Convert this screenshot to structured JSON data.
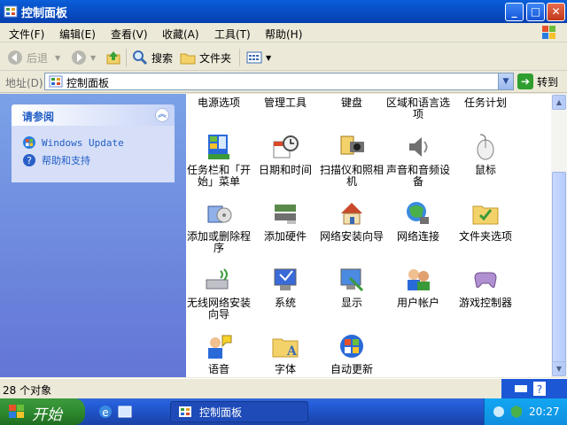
{
  "window": {
    "title": "控制面板",
    "buttons": {
      "minimize": "_",
      "maximize": "□",
      "close": "✕"
    }
  },
  "menu": [
    "文件(F)",
    "编辑(E)",
    "查看(V)",
    "收藏(A)",
    "工具(T)",
    "帮助(H)"
  ],
  "toolbar": {
    "back": "后退",
    "search": "搜索",
    "folders": "文件夹"
  },
  "address": {
    "label": "地址(D)",
    "value": "控制面板",
    "go": "转到"
  },
  "sidebar": {
    "title": "请参阅",
    "links": [
      {
        "label": "Windows Update",
        "icon": "windows-update-icon"
      },
      {
        "label": "帮助和支持",
        "icon": "help-icon"
      }
    ]
  },
  "items": [
    {
      "label": "电源选项",
      "icon": "power-options-icon"
    },
    {
      "label": "管理工具",
      "icon": "admin-tools-icon"
    },
    {
      "label": "键盘",
      "icon": "keyboard-icon"
    },
    {
      "label": "区域和语言选项",
      "icon": "regional-icon"
    },
    {
      "label": "任务计划",
      "icon": "scheduled-tasks-icon"
    },
    {
      "label": "任务栏和「开始」菜单",
      "icon": "taskbar-icon"
    },
    {
      "label": "日期和时间",
      "icon": "datetime-icon"
    },
    {
      "label": "扫描仪和照相机",
      "icon": "scanner-icon"
    },
    {
      "label": "声音和音频设备",
      "icon": "sound-icon"
    },
    {
      "label": "鼠标",
      "icon": "mouse-icon"
    },
    {
      "label": "添加或删除程序",
      "icon": "add-remove-icon"
    },
    {
      "label": "添加硬件",
      "icon": "add-hardware-icon"
    },
    {
      "label": "网络安装向导",
      "icon": "network-wizard-icon"
    },
    {
      "label": "网络连接",
      "icon": "network-connections-icon"
    },
    {
      "label": "文件夹选项",
      "icon": "folder-options-icon"
    },
    {
      "label": "无线网络安装向导",
      "icon": "wireless-wizard-icon"
    },
    {
      "label": "系统",
      "icon": "system-icon"
    },
    {
      "label": "显示",
      "icon": "display-icon"
    },
    {
      "label": "用户帐户",
      "icon": "user-accounts-icon"
    },
    {
      "label": "游戏控制器",
      "icon": "game-controller-icon"
    },
    {
      "label": "语音",
      "icon": "speech-icon"
    },
    {
      "label": "字体",
      "icon": "fonts-icon"
    },
    {
      "label": "自动更新",
      "icon": "auto-update-icon"
    }
  ],
  "status": {
    "text": "28 个对象"
  },
  "taskbar": {
    "start": "开始",
    "task": "控制面板",
    "clock": "20:27"
  }
}
